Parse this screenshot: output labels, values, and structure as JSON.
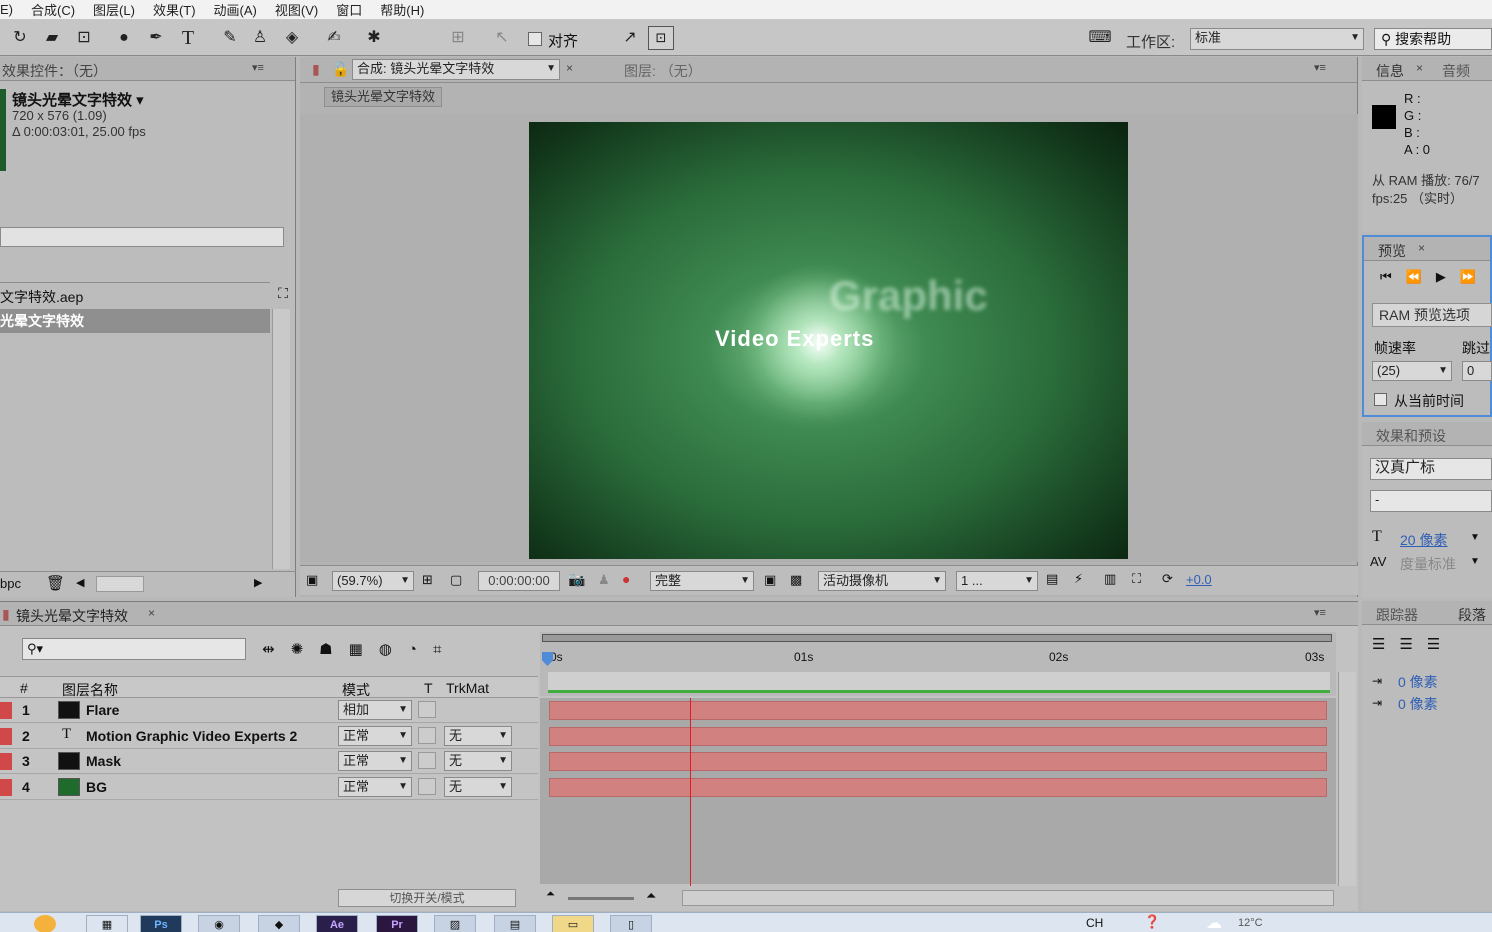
{
  "menu": [
    "E)",
    "合成(C)",
    "图层(L)",
    "效果(T)",
    "动画(A)",
    "视图(V)",
    "窗口",
    "帮助(H)"
  ],
  "toolbar": {
    "align_label": "对齐",
    "workspace_label": "工作区:",
    "workspace_value": "标准",
    "search_help": "搜索帮助"
  },
  "effect_controls": {
    "title": "效果控件：（无）",
    "comp_name": "镜头光晕文字特效 ▾",
    "comp_size": "720 x 576 (1.09)",
    "comp_duration": "Δ 0:00:03:01, 25.00 fps"
  },
  "project": {
    "file_item": "文字特效.aep",
    "comp_item": "光晕文字特效",
    "bpc": "bpc"
  },
  "composition": {
    "tab_label": "合成: 镜头光晕文字特效",
    "layer_tab": "图层: （无）",
    "breadcrumb": "镜头光晕文字特效",
    "frame_text_1": "Video Experts",
    "frame_text_2": "Graphic",
    "zoom": "(59.7%)",
    "timecode": "0:00:00:00",
    "resolution": "完整",
    "camera": "活动摄像机",
    "views": "1 ...",
    "exposure": "+0.0"
  },
  "info": {
    "tab_info": "信息",
    "tab_audio": "音频",
    "r": "R :",
    "g": "G :",
    "b": "B :",
    "a": "A : 0",
    "ram_line1": "从 RAM 播放: 76/7",
    "ram_line2": "fps:25 （实时）"
  },
  "preview": {
    "tab": "预览",
    "ram_options": "RAM 预览选项",
    "frame_rate_label": "帧速率",
    "skip_label": "跳过",
    "frame_rate_value": "(25)",
    "skip_value": "0",
    "from_current": "从当前时间"
  },
  "effects_presets": {
    "tab": "效果和预设",
    "font": "汉真广标",
    "style": "-",
    "size": "20 像素",
    "tracking": "度量标准"
  },
  "tracker": {
    "tab_tracker": "跟踪器",
    "tab_paragraph": "段落",
    "indent1": "0 像素",
    "indent2": "0 像素"
  },
  "timeline": {
    "tab": "镜头光晕文字特效",
    "col_num": "#",
    "col_name": "图层名称",
    "col_mode": "模式",
    "col_t": "T",
    "col_trkmat": "TrkMat",
    "ruler": [
      "0s",
      "01s",
      "02s",
      "03s"
    ],
    "toggle_label": "切换开关/模式",
    "layers": [
      {
        "num": "1",
        "name": "Flare",
        "mode": "相加",
        "trkmat": "",
        "swatch": "#111111"
      },
      {
        "num": "2",
        "name": "Motion Graphic Video Experts 2",
        "mode": "正常",
        "trkmat": "无",
        "swatch": "text"
      },
      {
        "num": "3",
        "name": "Mask",
        "mode": "正常",
        "trkmat": "无",
        "swatch": "#111111"
      },
      {
        "num": "4",
        "name": "BG",
        "mode": "正常",
        "trkmat": "无",
        "swatch": "#1f6b2c"
      }
    ]
  },
  "taskbar": {
    "apps": [
      "Ps",
      "Ae",
      "Pr"
    ],
    "lang": "CH",
    "temp": "12°C"
  }
}
